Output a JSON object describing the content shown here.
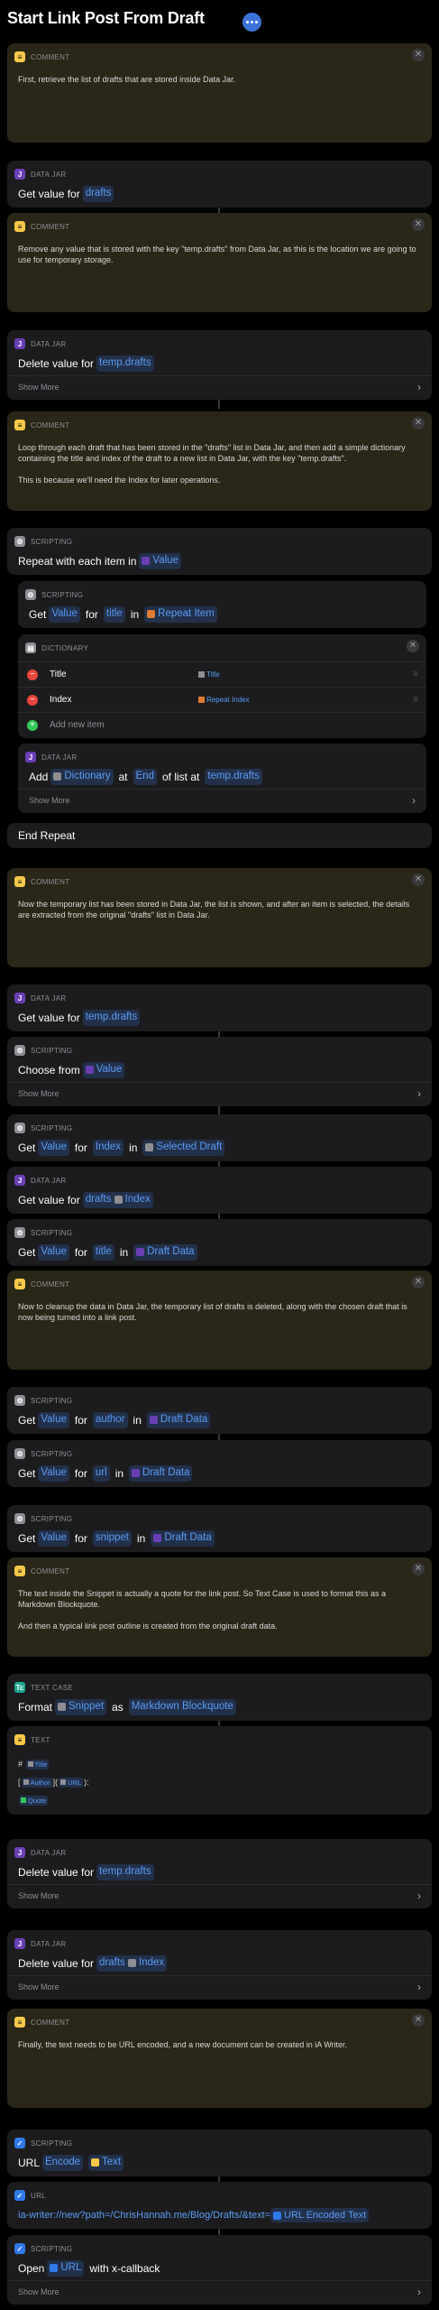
{
  "header": {
    "title": "Start Link Post From Draft",
    "more_icon": "ellipsis-icon"
  },
  "labels": {
    "comment": "COMMENT",
    "data_jar": "DATA JAR",
    "scripting": "SCRIPTING",
    "dictionary": "DICTIONARY",
    "text_case": "TEXT CASE",
    "text": "TEXT",
    "url": "URL",
    "show_more": "Show More"
  },
  "comments": [
    "First, retrieve the list of drafts that are stored inside Data Jar.",
    "Remove any value that is stored with the key \"temp.drafts\" from Data Jar, as this is the location we are going to use for temporary storage.",
    "Loop through each draft that has been stored in the \"drafts\" list in Data Jar, and then add a simple dictionary containing the title and index of the draft to a new list in Data Jar, with the key \"temp.drafts\".\n\nThis is because we'll need the Index for later operations.",
    "Now the temporary list has been stored in Data Jar, the list is shown, and after an item is selected, the details are extracted from the original \"drafts\" list in Data Jar.",
    "Now to cleanup the data in Data Jar, the temporary list of drafts is deleted, along with the chosen draft that is now being turned into a link post.",
    "The text inside the Snippet is actually a quote for the link post. So Text Case is used to format this as a Markdown Blockquote.\n\nAnd then a typical link post outline is created from the original draft data.",
    "Finally, the text needs to be URL encoded, and a new document can be created in iA Writer."
  ],
  "actions": {
    "get_value_for": "Get value for",
    "delete_value_for": "Delete value for",
    "repeat_with_each_item_in": "Repeat with each item in",
    "get": "Get",
    "for": "for",
    "in": "in",
    "value": "Value",
    "add": "Add",
    "at": "at",
    "of_list_at": "of list at",
    "end_repeat": "End Repeat",
    "choose_from": "Choose from",
    "format": "Format",
    "as": "as",
    "url": "URL",
    "encode": "Encode",
    "open": "Open",
    "with_x_callback": "with x-callback"
  },
  "tokens": {
    "drafts": "drafts",
    "temp_drafts": "temp.drafts",
    "value": "Value",
    "title": "title",
    "repeat_item": "Repeat Item",
    "dictionary": "Dictionary",
    "end": "End",
    "index": "Index",
    "selected_draft": "Selected Draft",
    "draft_data": "Draft Data",
    "author": "author",
    "url": "url",
    "snippet": "snippet",
    "snippet_var": "Snippet",
    "markdown_blockquote": "Markdown Blockquote",
    "text": "Text",
    "url_var": "URL",
    "url_encoded_text": "URL Encoded Text"
  },
  "dictionary": {
    "rows": [
      {
        "key": "Title",
        "value": "Title"
      },
      {
        "key": "Index",
        "value": "Repeat Index"
      }
    ],
    "add_new_item": "Add new item"
  },
  "text_block": {
    "hash": "#",
    "title": "Title",
    "author": "Author",
    "url": "URL",
    "quote": "Quote"
  },
  "ia_url": "ia-writer://new?path=/ChrisHannah.me/Blog/Drafts/&text="
}
